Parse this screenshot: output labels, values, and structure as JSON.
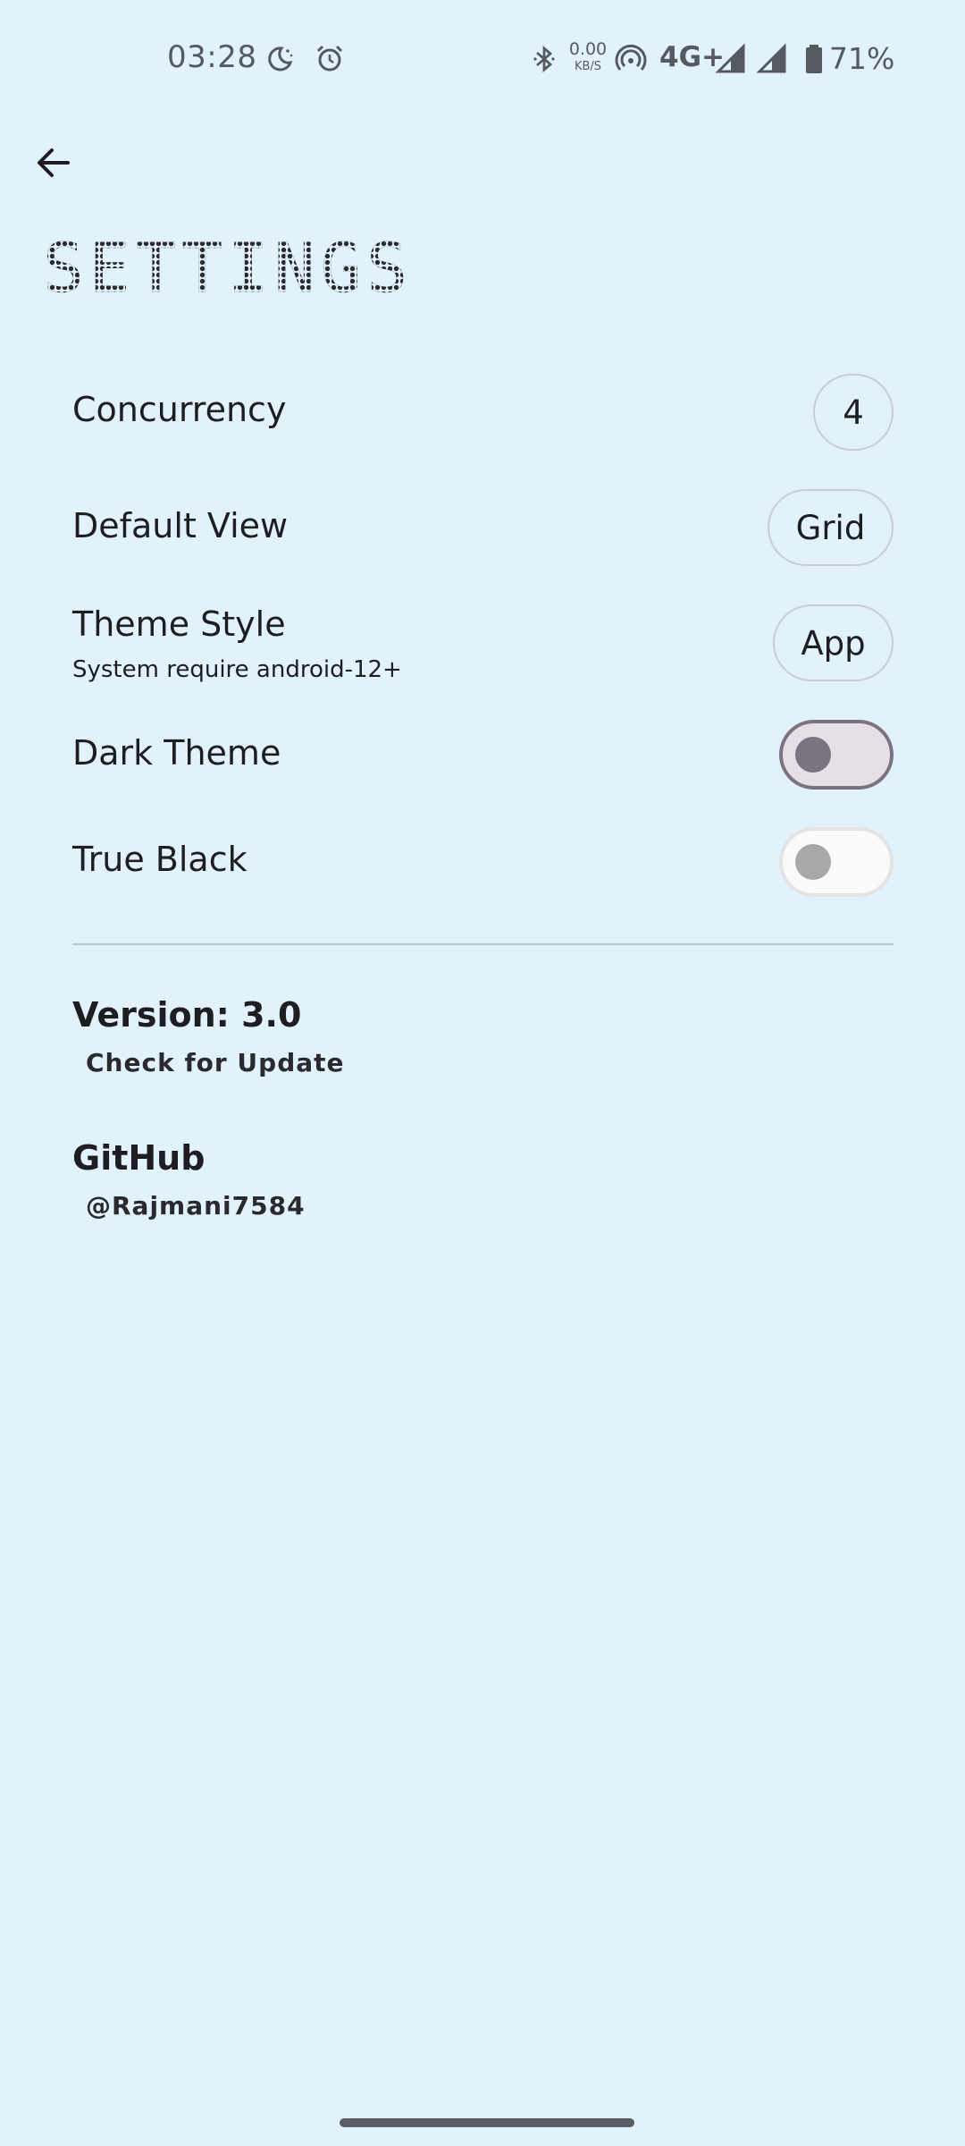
{
  "status_bar": {
    "time": "03:28",
    "net_speed_value": "0.00",
    "net_speed_unit": "KB/S",
    "network_type": "4G+",
    "battery": "71%",
    "icons": [
      "moon-icon",
      "alarm-icon",
      "bluetooth-icon",
      "hotspot-icon",
      "signal-icon",
      "battery-icon"
    ]
  },
  "header": {
    "back_icon": "arrow-left-icon",
    "title": "SETTINGS"
  },
  "settings": {
    "concurrency": {
      "label": "Concurrency",
      "value": "4"
    },
    "default_view": {
      "label": "Default View",
      "value": "Grid"
    },
    "theme_style": {
      "label": "Theme Style",
      "sublabel": "System require android-12+",
      "value": "App"
    },
    "dark_theme": {
      "label": "Dark Theme",
      "enabled": false
    },
    "true_black": {
      "label": "True Black",
      "enabled": false
    }
  },
  "about": {
    "version_title": "Version: 3.0",
    "update_link": "Check for Update",
    "github_title": "GitHub",
    "github_handle": "@Rajmani7584"
  },
  "colors": {
    "background": "#e2f2fd",
    "text": "#1d1d22",
    "toggle_dark_border": "#7b7480",
    "toggle_dark_fill": "#e6dfe6"
  }
}
